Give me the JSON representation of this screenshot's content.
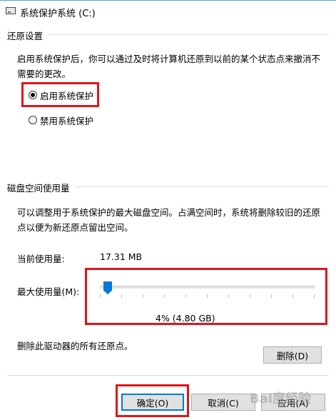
{
  "window": {
    "title": "系统保护系统 (C:)"
  },
  "restore": {
    "group_title": "还原设置",
    "description": "启用系统保护后，你可以通过及时将计算机还原到以前的某个状态点来撤消不需要的更改。",
    "options": [
      {
        "label": "启用系统保护",
        "selected": true
      },
      {
        "label": "禁用系统保护",
        "selected": false
      }
    ]
  },
  "disk": {
    "group_title": "磁盘空间使用量",
    "description": "可以调整用于系统保护的最大磁盘空间。占满空间时，系统将删除较旧的还原点以便为新还原点留出空间。",
    "current_label": "当前使用量:",
    "current_value": "17.31 MB",
    "max_label": "最大使用量(M):",
    "slider_percent": 4,
    "slider_value_text": "4% (4.80 GB)"
  },
  "delete_section": {
    "text": "删除此驱动器的所有还原点。",
    "button_label": "删除(D)"
  },
  "footer": {
    "ok_label": "确定(O)",
    "cancel_label": "取消(C)",
    "apply_label": "应用(A)"
  },
  "watermark": {
    "text": "Bai度经验"
  },
  "colors": {
    "highlight_box": "#e0141c",
    "accent": "#0078d7"
  }
}
